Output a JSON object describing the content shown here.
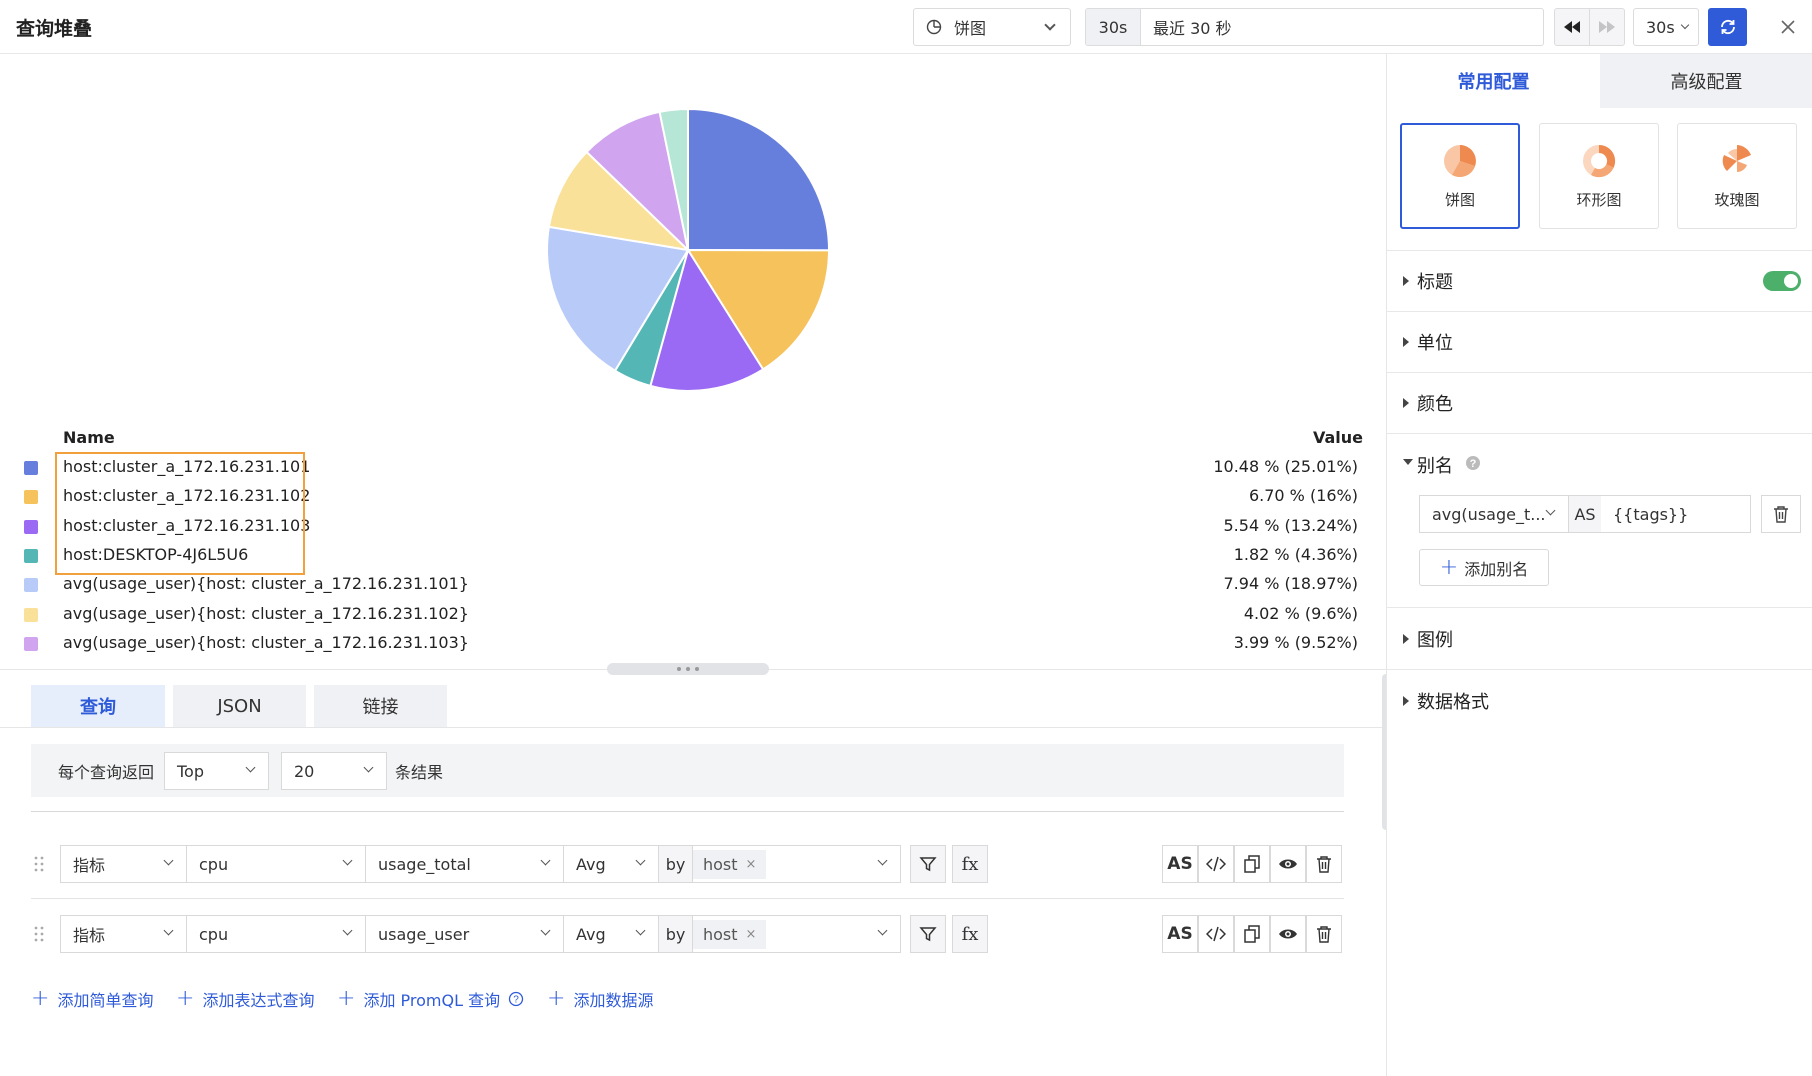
{
  "header": {
    "title": "查询堆叠",
    "chart_type_label": "饼图",
    "time_short": "30s",
    "time_range": "最近 30 秒",
    "refresh_interval": "30s"
  },
  "chart_data": {
    "type": "pie",
    "legend_header_name": "Name",
    "legend_header_value": "Value",
    "slices": [
      {
        "name": "host:cluster_a_172.16.231.101",
        "value": 10.48,
        "label": "10.48 % (25.01%)",
        "color": "#677fdc"
      },
      {
        "name": "host:cluster_a_172.16.231.102",
        "value": 6.7,
        "label": "6.70 % (16%)",
        "color": "#f5c25b"
      },
      {
        "name": "host:cluster_a_172.16.231.103",
        "value": 5.54,
        "label": "5.54 % (13.24%)",
        "color": "#9b6af4"
      },
      {
        "name": "host:DESKTOP-4J6L5U6",
        "value": 1.82,
        "label": "1.82 % (4.36%)",
        "color": "#55b6b6"
      },
      {
        "name": "avg(usage_user){host: cluster_a_172.16.231.101}",
        "value": 7.94,
        "label": "7.94 % (18.97%)",
        "color": "#b8cbf8"
      },
      {
        "name": "avg(usage_user){host: cluster_a_172.16.231.102}",
        "value": 4.02,
        "label": "4.02 % (9.6%)",
        "color": "#f9e19a"
      },
      {
        "name": "avg(usage_user){host: cluster_a_172.16.231.103}",
        "value": 3.99,
        "label": "3.99 % (9.52%)",
        "color": "#d0a4ee"
      },
      {
        "name": "",
        "value": 1.35,
        "label": "",
        "color": "#b5e6d6"
      }
    ],
    "highlight_color": "#f0a03c"
  },
  "query_tabs": [
    "查询",
    "JSON",
    "链接"
  ],
  "limit": {
    "prefix": "每个查询返回",
    "order": "Top",
    "count": "20",
    "suffix": "条结果"
  },
  "queries": [
    {
      "type": "指标",
      "measurement": "cpu",
      "field": "usage_total",
      "agg": "Avg",
      "by": "by",
      "tag": "host",
      "filter_icon": "filter-icon",
      "fx": "fx"
    },
    {
      "type": "指标",
      "measurement": "cpu",
      "field": "usage_user",
      "agg": "Avg",
      "by": "by",
      "tag": "host",
      "filter_icon": "filter-icon",
      "fx": "fx"
    }
  ],
  "row_actions": {
    "as": "AS"
  },
  "add_links": {
    "simple": "添加简单查询",
    "expr": "添加表达式查询",
    "promql": "添加 PromQL 查询",
    "datasource": "添加数据源"
  },
  "right_panel": {
    "tabs": [
      "常用配置",
      "高级配置"
    ],
    "chart_types": [
      "饼图",
      "环形图",
      "玫瑰图"
    ],
    "sections": [
      "标题",
      "单位",
      "颜色",
      "别名",
      "图例",
      "数据格式"
    ],
    "alias": {
      "source": "avg(usage_t...",
      "as": "AS",
      "target": "{{tags}}",
      "add_label": "添加别名"
    }
  },
  "colors": {
    "accent": "#2f5bd9",
    "toggle_on": "#4caf6a"
  }
}
